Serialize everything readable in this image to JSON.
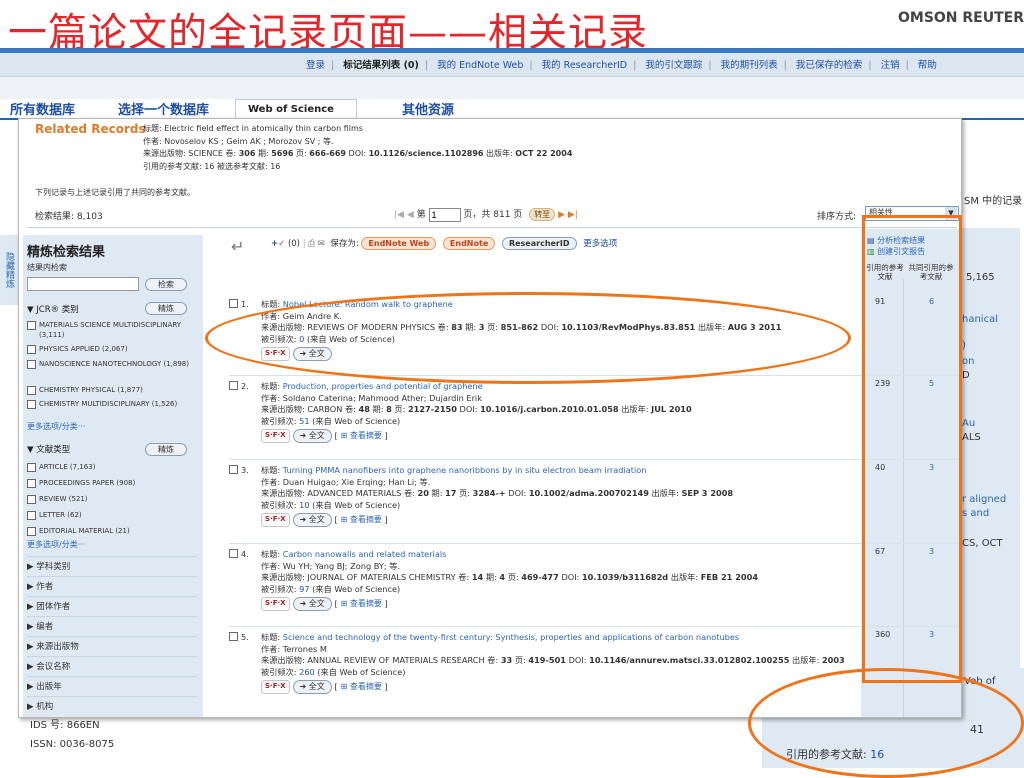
{
  "slide_title": "一篇论文的全记录页面——相关记录",
  "brand": "OMSON REUTER",
  "topnav": {
    "login": "登录",
    "marked": "标记结果列表",
    "marked_count": "(0)",
    "endnote": "我的 EndNote Web",
    "researcherid": "我的 ResearcherID",
    "citation_alert": "我的引文跟踪",
    "journal_list": "我的期刊列表",
    "saved_search": "我已保存的检索",
    "logout": "注销",
    "help": "帮助"
  },
  "tabs": {
    "all_db": "所有数据库",
    "select_db": "选择一个数据库",
    "wos": "Web of Science",
    "other": "其他资源"
  },
  "background": {
    "right_records": "SM 中的记录",
    "right_items": [
      "5,165",
      "hanical",
      ")",
      "on",
      "D",
      "Au",
      "ALS",
      "r aligned",
      "s and",
      "CS, OCT",
      "Veb of"
    ],
    "ids": "IDS 号: 866EN",
    "issn": "ISSN: 0036-8075",
    "cited_count": "41",
    "cited_refs_label": "引用的参考文献:",
    "cited_refs_value": "16"
  },
  "left_vertical": "隐藏精炼",
  "popup": {
    "label": "Related Records",
    "meta_title": "标题: Electric field effect in atomically thin carbon films",
    "meta_authors": "作者: Novoselov KS ; Geim AK ; Morozov SV ; 等.",
    "meta_source_prefix": "来源出版物: SCIENCE 卷: ",
    "meta_volume": "306",
    "meta_issue_prefix": " 期: ",
    "meta_issue": "5696",
    "meta_pages_prefix": " 页: ",
    "meta_pages": "666-669",
    "meta_doi_prefix": " DOI: ",
    "meta_doi": "10.1126/science.1102896",
    "meta_date_prefix": " 出版年: ",
    "meta_date": "OCT 22 2004",
    "meta_refs": "引用的参考文献: 16 被选参考文献: 16",
    "shared_note": "下列记录与上述记录引用了共同的参考文献。",
    "count_label": "检索结果:",
    "count_value": "8,103",
    "pager_prefix": "第",
    "page_value": "1",
    "pager_suffix": "页，共 811 页",
    "go": "转至",
    "sort_label": "排序方式:",
    "sort_value": "相关性"
  },
  "sidebar": {
    "title": "精炼检索结果",
    "search_within": "结果内检索",
    "search_btn": "检索",
    "jcr_label": "JCR® 类别",
    "refine_btn": "精炼",
    "jcr_items": [
      "MATERIALS SCIENCE MULTIDISCIPLINARY (3,111)",
      "PHYSICS APPLIED (2,067)",
      "NANOSCIENCE NANOTECHNOLOGY (1,898)",
      "CHEMISTRY PHYSICAL (1,877)",
      "CHEMISTRY MULTIDISCIPLINARY (1,526)"
    ],
    "more_options": "更多选项/分类···",
    "doctype_label": "文献类型",
    "doctype_items": [
      "ARTICLE (7,163)",
      "PROCEEDINGS PAPER (908)",
      "REVIEW (521)",
      "LETTER (62)",
      "EDITORIAL MATERIAL (21)"
    ],
    "collapsed": [
      "学科类别",
      "作者",
      "团体作者",
      "编者",
      "来源出版物",
      "会议名称",
      "出版年",
      "机构"
    ]
  },
  "toolbar": {
    "count": "(0)",
    "save_to": "保存为:",
    "endnote_web": "EndNote Web",
    "endnote": "EndNote",
    "researcherid": "ResearcherID",
    "more": "更多选项"
  },
  "analysis": {
    "analyze": "分析检索结果",
    "citation_report": "创建引文报告",
    "col_cited": "引用的参考文献",
    "col_shared": "共同引用的参考文献"
  },
  "records": [
    {
      "num": "1.",
      "title": "Nobel Lecture: Random walk to graphene",
      "authors": "Geim Andre K.",
      "source": "REVIEWS OF MODERN PHYSICS",
      "vol": "83",
      "issue": "3",
      "pages": "851-862",
      "doi": "10.1103/RevModPhys.83.851",
      "date": "AUG 3 2011",
      "times_cited": "0",
      "cited_refs": "91",
      "shared_refs": "6"
    },
    {
      "num": "2.",
      "title": "Production, properties and potential of graphene",
      "authors": "Soldano Caterina; Mahmood Ather; Dujardin Erik",
      "source": "CARBON",
      "vol": "48",
      "issue": "8",
      "pages": "2127-2150",
      "doi": "10.1016/j.carbon.2010.01.058",
      "date": "JUL 2010",
      "times_cited": "51",
      "cited_refs": "239",
      "shared_refs": "5"
    },
    {
      "num": "3.",
      "title": "Turning PMMA nanofibers into graphene nanoribbons by in situ electron beam irradiation",
      "authors": "Duan Huigao; Xie Erqing; Han Li; 等.",
      "source": "ADVANCED MATERIALS",
      "vol": "20",
      "issue": "17",
      "pages": "3284-+",
      "doi": "10.1002/adma.200702149",
      "date": "SEP 3 2008",
      "times_cited": "10",
      "cited_refs": "40",
      "shared_refs": "3"
    },
    {
      "num": "4.",
      "title": "Carbon nanowalls and related materials",
      "authors": "Wu YH; Yang BJ; Zong BY; 等.",
      "source": "JOURNAL OF MATERIALS CHEMISTRY",
      "vol": "14",
      "issue": "4",
      "pages": "469-477",
      "doi": "10.1039/b311682d",
      "date": "FEB 21 2004",
      "times_cited": "97",
      "cited_refs": "67",
      "shared_refs": "3"
    },
    {
      "num": "5.",
      "title": "Science and technology of the twenty-first century: Synthesis, properties and applications of carbon nanotubes",
      "authors": "Terrones M",
      "source": "ANNUAL REVIEW OF MATERIALS RESEARCH",
      "vol": "33",
      "issue": "",
      "pages": "419-501",
      "doi": "10.1146/annurev.matsci.33.012802.100255",
      "date": "2003",
      "times_cited": "260",
      "cited_refs": "360",
      "shared_refs": "3"
    }
  ],
  "labels": {
    "title": "标题:",
    "authors": "作者:",
    "source": "来源出版物:",
    "vol": "卷:",
    "issue": "期:",
    "pages": "页:",
    "doi": "DOI:",
    "date": "出版年:",
    "cited": "被引频次:",
    "from_wos": "(来自 Web of Science)",
    "fulltext": "全文",
    "abstract": "查看摘要",
    "sfx": "S·F·X"
  },
  "colors": {
    "title_red": "#e4262b",
    "highlight_orange": "#f07318",
    "link_blue": "#2b65b4"
  }
}
